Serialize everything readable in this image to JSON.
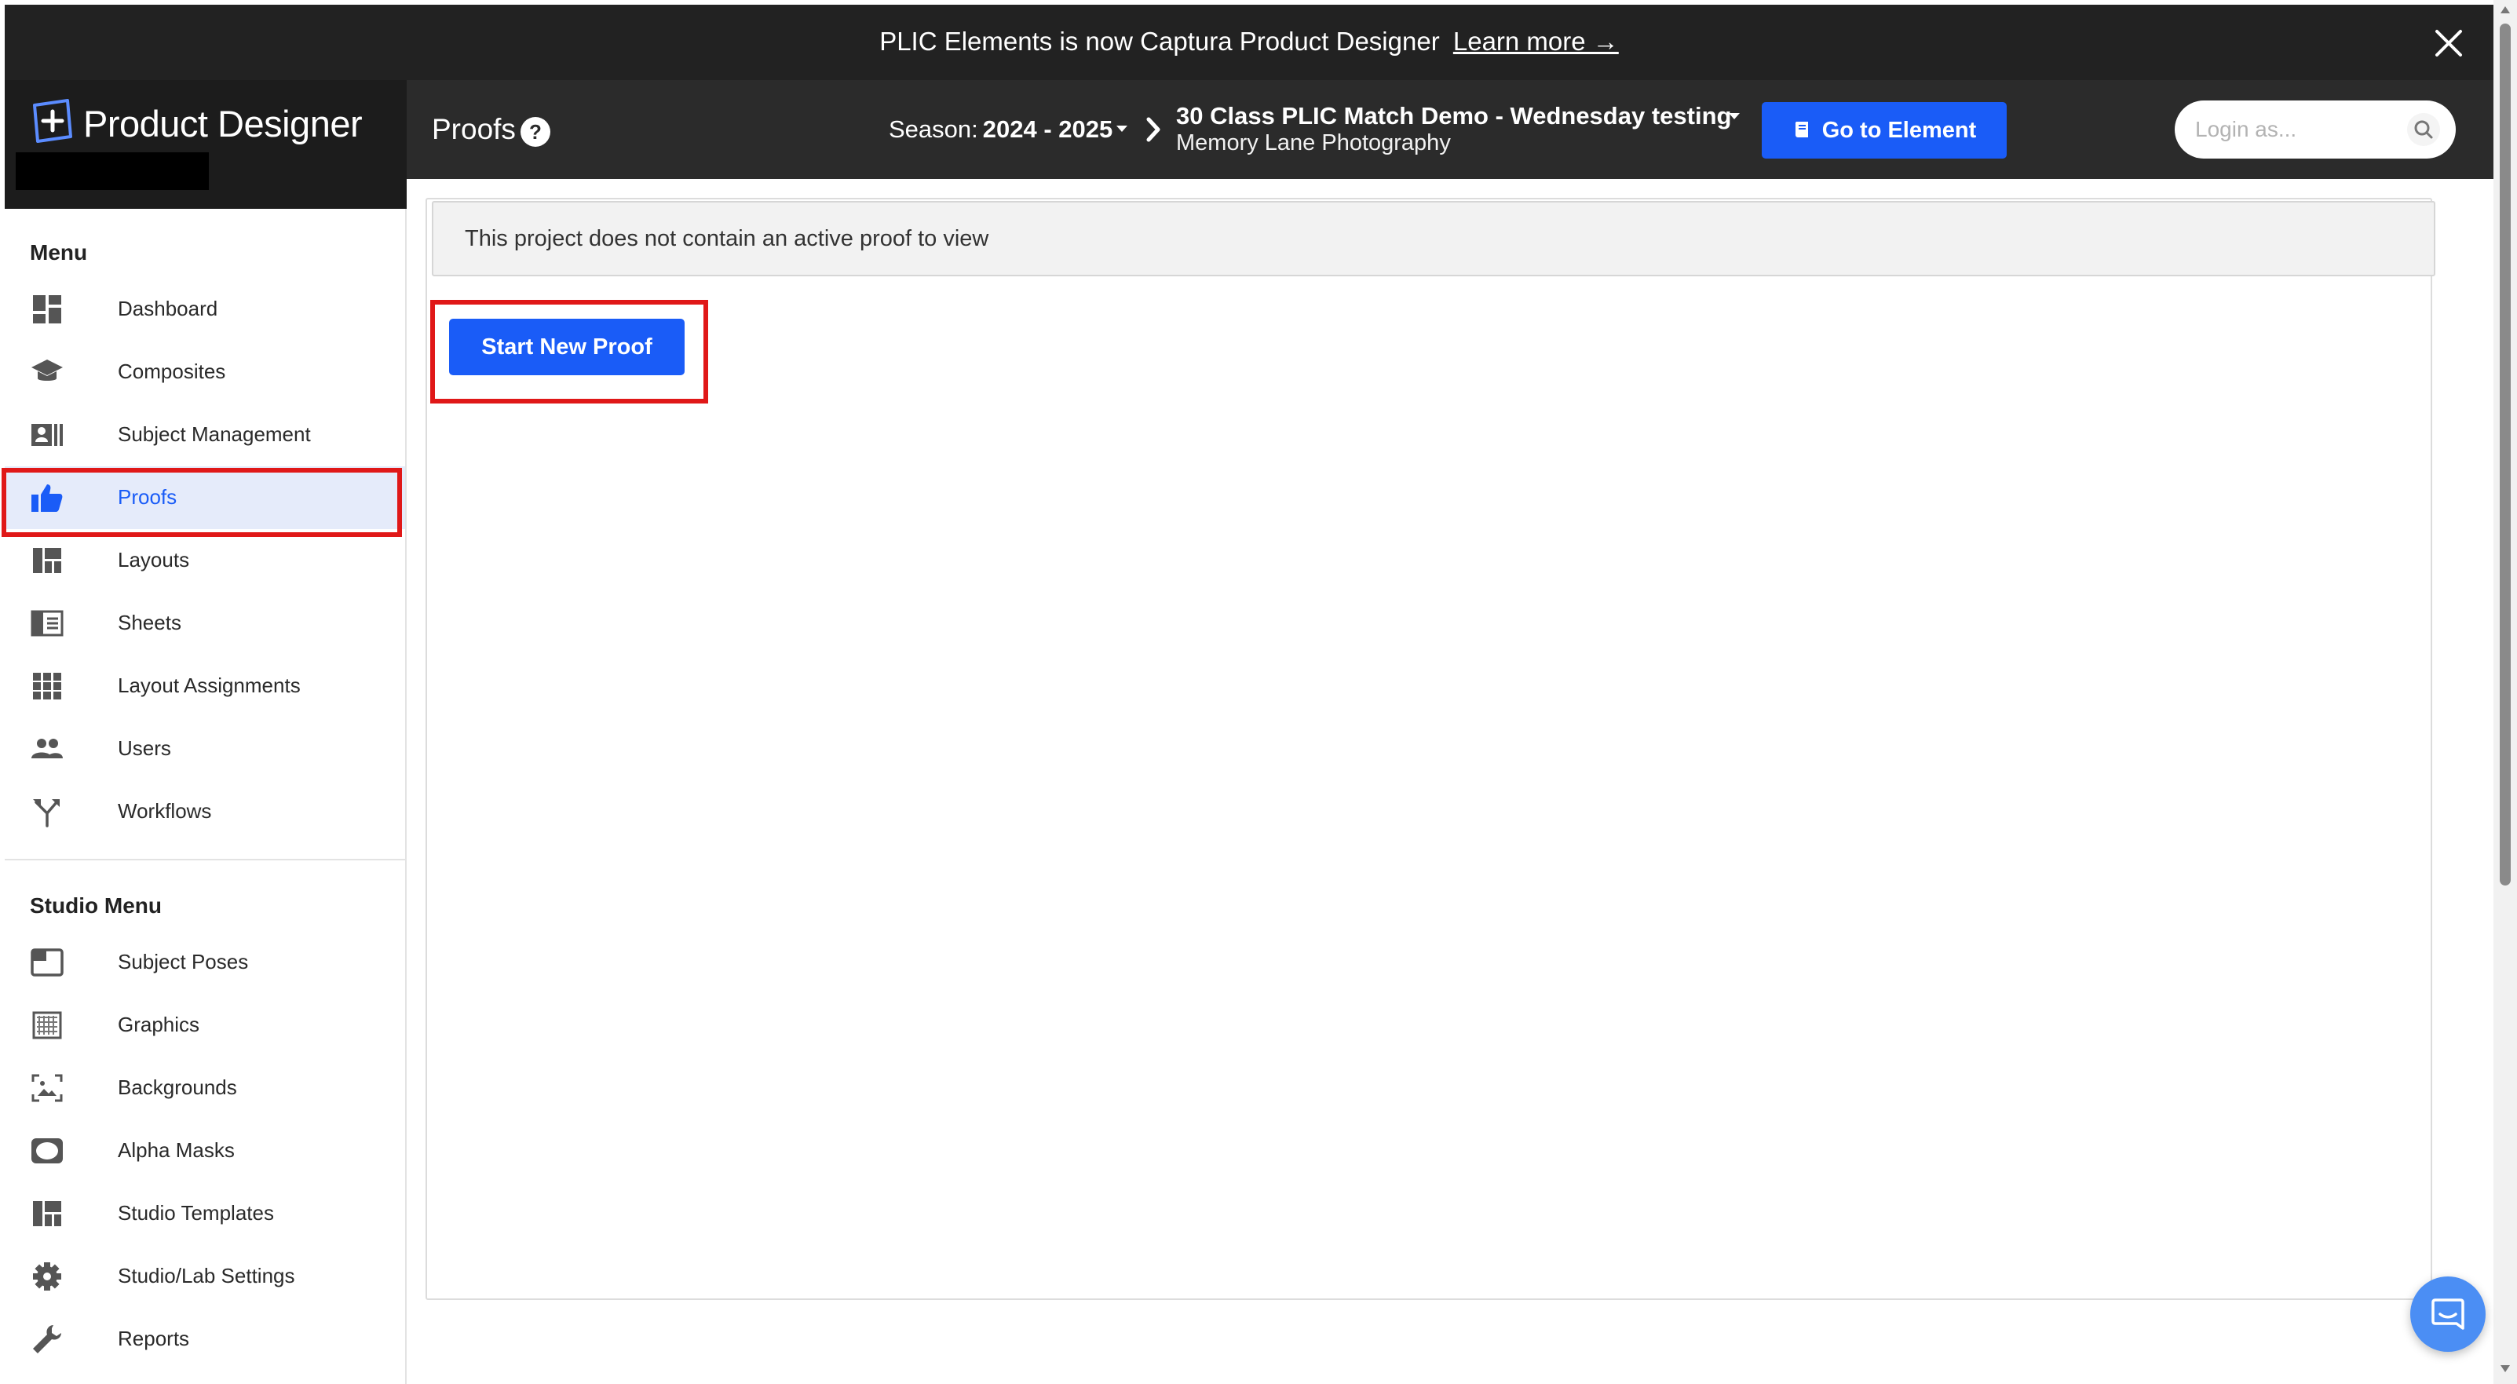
{
  "banner": {
    "text": "PLIC Elements is now Captura Product Designer",
    "link_label": "Learn more →"
  },
  "app": {
    "name": "Product Designer"
  },
  "header": {
    "page_title": "Proofs",
    "season_label": "Season:",
    "season_value": "2024 - 2025",
    "project_name": "30 Class PLIC Match Demo - Wednesday testing",
    "studio_name": "Memory Lane Photography",
    "goto_button": "Go to Element",
    "login_placeholder": "Login as..."
  },
  "sidebar": {
    "menu_title": "Menu",
    "menu_items": [
      {
        "label": "Dashboard",
        "icon": "dashboard-icon"
      },
      {
        "label": "Composites",
        "icon": "graduation-cap-icon"
      },
      {
        "label": "Subject Management",
        "icon": "id-card-icon"
      },
      {
        "label": "Proofs",
        "icon": "thumbs-up-icon",
        "active": true
      },
      {
        "label": "Layouts",
        "icon": "layout-icon"
      },
      {
        "label": "Sheets",
        "icon": "sheet-icon"
      },
      {
        "label": "Layout Assignments",
        "icon": "grid-icon"
      },
      {
        "label": "Users",
        "icon": "users-icon"
      },
      {
        "label": "Workflows",
        "icon": "workflow-icon"
      }
    ],
    "studio_title": "Studio Menu",
    "studio_items": [
      {
        "label": "Subject Poses",
        "icon": "pose-frame-icon"
      },
      {
        "label": "Graphics",
        "icon": "graphics-icon"
      },
      {
        "label": "Backgrounds",
        "icon": "background-image-icon"
      },
      {
        "label": "Alpha Masks",
        "icon": "mask-icon"
      },
      {
        "label": "Studio Templates",
        "icon": "template-icon"
      },
      {
        "label": "Studio/Lab Settings",
        "icon": "gear-icon"
      },
      {
        "label": "Reports",
        "icon": "wrench-icon"
      }
    ]
  },
  "main": {
    "alert_text": "This project does not contain an active proof to view",
    "start_button": "Start New Proof"
  },
  "colors": {
    "accent": "#1a5cf7",
    "highlight": "#e01818",
    "active_bg": "#e5ebfa",
    "header_bg": "#2b2b2b"
  }
}
